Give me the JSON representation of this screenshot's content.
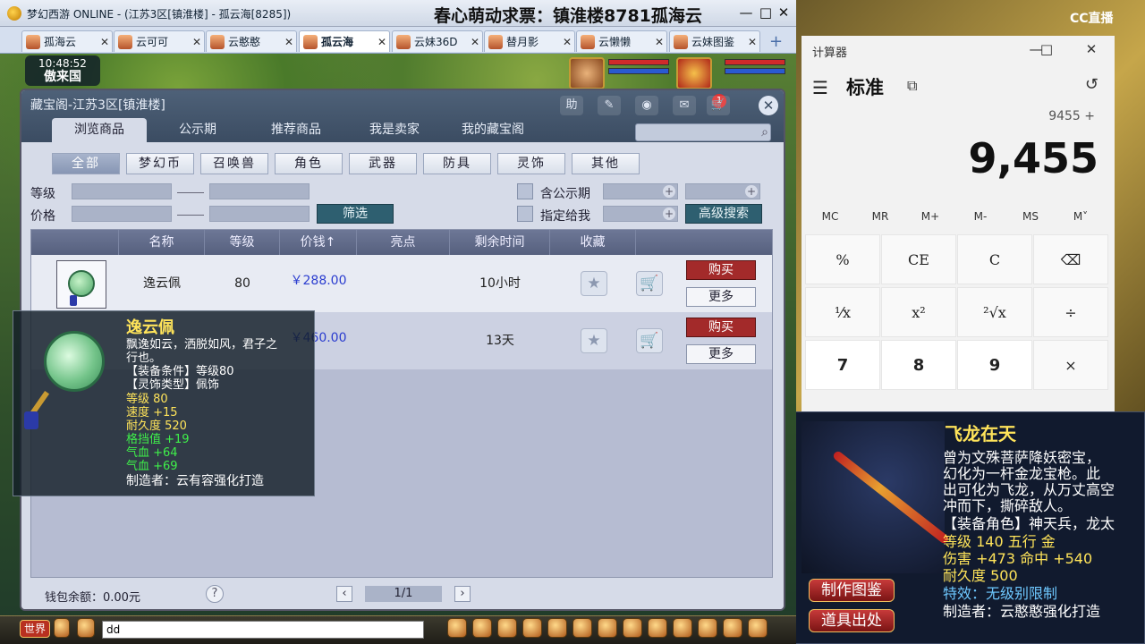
{
  "game_window": {
    "title": "梦幻西游 ONLINE - (江苏3区[镇淮楼] - 孤云海[8285])",
    "stream_title": "春心萌动求票：镇淮楼8781孤海云",
    "controls": {
      "minimize": "—",
      "maximize": "□",
      "close": "✕"
    },
    "tabs": [
      {
        "label": "孤海云",
        "close": "✕",
        "active": false
      },
      {
        "label": "云可可",
        "close": "✕",
        "active": false
      },
      {
        "label": "云憨憨",
        "close": "✕",
        "active": false
      },
      {
        "label": "孤云海",
        "close": "✕",
        "active": true
      },
      {
        "label": "云妹36D",
        "close": "✕",
        "active": false
      },
      {
        "label": "替月影",
        "close": "✕",
        "active": false
      },
      {
        "label": "云懒懒",
        "close": "✕",
        "active": false
      },
      {
        "label": "云妹图鉴",
        "close": "✕",
        "active": false
      }
    ],
    "add_tab": "+",
    "clock": {
      "time": "10:48:52",
      "place": "傲来国"
    },
    "bottom": {
      "channel": "世界",
      "chat_value": "dd"
    }
  },
  "dialog": {
    "title": "藏宝阁-江苏3区[镇淮楼]",
    "header_icons": {
      "help": "助",
      "share": "✎",
      "record": "◉",
      "message": "✉",
      "cart": "🛒"
    },
    "message_badge": "1",
    "close": "✕",
    "main_tabs": [
      "浏览商品",
      "公示期",
      "推荐商品",
      "我是卖家",
      "我的藏宝阁"
    ],
    "categories": [
      "全部",
      "梦幻币",
      "召唤兽",
      "角色",
      "武器",
      "防具",
      "灵饰",
      "其他"
    ],
    "filters": {
      "level_label": "等级",
      "price_label": "价格",
      "filter_button": "筛选",
      "public_label": "含公示期",
      "assign_label": "指定给我",
      "advanced_button": "高级搜索"
    },
    "columns": [
      "名称",
      "等级",
      "价钱↑",
      "亮点",
      "剩余时间",
      "收藏"
    ],
    "rows": [
      {
        "name": "逸云佩",
        "level": "80",
        "price": "￥288.00",
        "remaining": "10小时",
        "buy": "购买",
        "more": "更多"
      },
      {
        "name": "",
        "level": "",
        "price": "￥460.00",
        "remaining": "13天",
        "buy": "购买",
        "more": "更多"
      }
    ],
    "wallet": "钱包余额：0.00元",
    "help": "?",
    "page": "1/1",
    "prev": "‹",
    "next": "›"
  },
  "tooltip": {
    "name": "逸云佩",
    "desc_1": "飘逸如云，洒脱如风，君子之",
    "desc_2": "行也。",
    "req": "【装备条件】等级80",
    "type": "【灵饰类型】佩饰",
    "stats_yellow": [
      "等级 80",
      "速度 +15",
      "耐久度 520"
    ],
    "stats_green": [
      "格挡值 +19",
      "气血 +64",
      "气血 +69"
    ],
    "maker": "制造者：云有容强化打造"
  },
  "calculator": {
    "app_title": "计算器",
    "mode": "标准",
    "expression": "9455 +",
    "display": "9,455",
    "memory_keys": [
      "MC",
      "MR",
      "M+",
      "M-",
      "MS",
      "M˅"
    ],
    "keys": [
      "%",
      "CE",
      "C",
      "⌫",
      "¹⁄x",
      "x²",
      "²√x",
      "÷",
      "7",
      "8",
      "9",
      "×"
    ]
  },
  "overlay": {
    "watermark": "CC直播",
    "item_card": {
      "title": "飞龙在天",
      "desc": [
        "曾为文殊菩萨降妖密宝，",
        "幻化为一杆金龙宝枪。此",
        "出可化为飞龙，从万丈高空",
        "冲而下，撕碎敌人。"
      ],
      "role": "【装备角色】神天兵，龙太",
      "stats": [
        "等级 140  五行 金",
        "伤害 +473  命中 +540",
        "耐久度 500"
      ],
      "effect": "特效：无级别限制",
      "maker": "制造者：云憨憨强化打造",
      "buttons": [
        "制作图鉴",
        "道具出处"
      ]
    }
  },
  "colors": {
    "buy": "#a32a2a",
    "price": "#2a3ccf",
    "tip_green": "#3ff04a",
    "tip_yellow": "#ffe45a"
  }
}
